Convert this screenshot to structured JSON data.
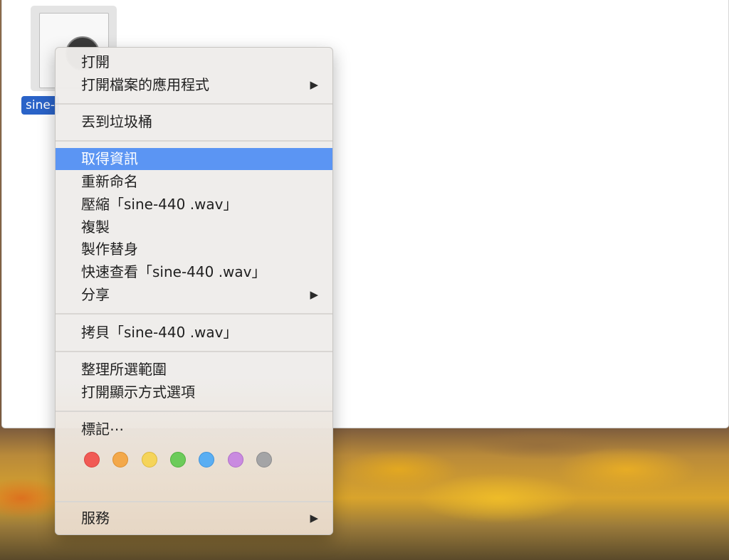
{
  "desktop": {
    "wallpaper": "macOS High Sierra autumn"
  },
  "file": {
    "name": "sine-",
    "icon": "audio-file-icon"
  },
  "menu": {
    "items": [
      {
        "label": "打開",
        "submenu": false
      },
      {
        "label": "打開檔案的應用程式",
        "submenu": true
      },
      {
        "label": "丟到垃圾桶",
        "submenu": false
      },
      {
        "label": "取得資訊",
        "submenu": false,
        "highlighted": true
      },
      {
        "label": "重新命名",
        "submenu": false
      },
      {
        "label": "壓縮「sine-440 .wav」",
        "submenu": false
      },
      {
        "label": "複製",
        "submenu": false
      },
      {
        "label": "製作替身",
        "submenu": false
      },
      {
        "label": "快速查看「sine-440 .wav」",
        "submenu": false
      },
      {
        "label": "分享",
        "submenu": true
      },
      {
        "label": "拷貝「sine-440 .wav」",
        "submenu": false
      },
      {
        "label": "整理所選範圍",
        "submenu": false
      },
      {
        "label": "打開顯示方式選項",
        "submenu": false
      },
      {
        "label": "標記⋯",
        "submenu": false
      },
      {
        "label": "服務",
        "submenu": true
      }
    ],
    "submenu_arrow": "▶",
    "tags": [
      {
        "name": "red",
        "fill": "#f15a55",
        "stroke": "#d94440"
      },
      {
        "name": "orange",
        "fill": "#f3a84a",
        "stroke": "#dc8f31"
      },
      {
        "name": "yellow",
        "fill": "#f5d45a",
        "stroke": "#ddba3f"
      },
      {
        "name": "green",
        "fill": "#6ccb5a",
        "stroke": "#52b141"
      },
      {
        "name": "blue",
        "fill": "#5aaef3",
        "stroke": "#3f93dc"
      },
      {
        "name": "purple",
        "fill": "#c98ae0",
        "stroke": "#b070c8"
      },
      {
        "name": "gray",
        "fill": "#a4a4a6",
        "stroke": "#8b8b8d"
      }
    ]
  },
  "colors": {
    "highlight": "#5b95f3",
    "selection": "#2a63c8"
  }
}
